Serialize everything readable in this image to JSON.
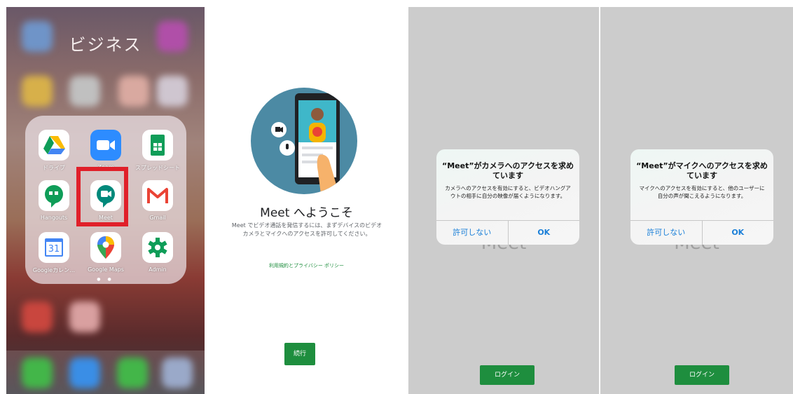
{
  "panel1": {
    "folder_title": "ビジネス",
    "apps": [
      {
        "label": "ドライブ",
        "icon": "google-drive-icon",
        "color": "#ffffff"
      },
      {
        "label": "Zoom",
        "icon": "zoom-icon",
        "color": "#2d8cff"
      },
      {
        "label": "スプレッドシート",
        "icon": "google-sheets-icon",
        "color": "#0f9d58"
      },
      {
        "label": "Hangouts",
        "icon": "hangouts-icon",
        "color": "#0f9d58"
      },
      {
        "label": "Meet",
        "icon": "google-meet-icon",
        "color": "#00897b"
      },
      {
        "label": "Gmail",
        "icon": "gmail-icon",
        "color": "#ea4335"
      },
      {
        "label": "Googleカレン…",
        "icon": "google-calendar-icon",
        "color": "#4285f4"
      },
      {
        "label": "Google Maps",
        "icon": "google-maps-icon",
        "color": "#34a853"
      },
      {
        "label": "Admin",
        "icon": "google-admin-icon",
        "color": "#0f9d58"
      }
    ],
    "calendar_day": "31",
    "highlight_color": "#e0202a"
  },
  "panel2": {
    "title": "Meet へようこそ",
    "body": "Meet でビデオ通話を発信するには、まずデバイスのビデオカメラとマイクへのアクセスを許可してください。",
    "policy_link": "利用規約とプライバシー ポリシー",
    "continue_button": "続行"
  },
  "panel3": {
    "background_text": "Meet",
    "alert_title": "“Meet”がカメラへのアクセスを求めています",
    "alert_message": "カメラへのアクセスを有効にすると、ビデオハングアウトの相手に自分の映像が届くようになります。",
    "deny_button": "許可しない",
    "ok_button": "OK",
    "login_button": "ログイン"
  },
  "panel4": {
    "background_text": "Meet",
    "alert_title": "“Meet”がマイクへのアクセスを求めています",
    "alert_message": "マイクへのアクセスを有効にすると、他のユーザーに自分の声が聞こえるようになります。",
    "deny_button": "許可しない",
    "ok_button": "OK",
    "login_button": "ログイン"
  },
  "colors": {
    "meet_green": "#1e8e3e",
    "ios_blue": "#1a7fd8",
    "gray_bg": "#cccccc"
  }
}
